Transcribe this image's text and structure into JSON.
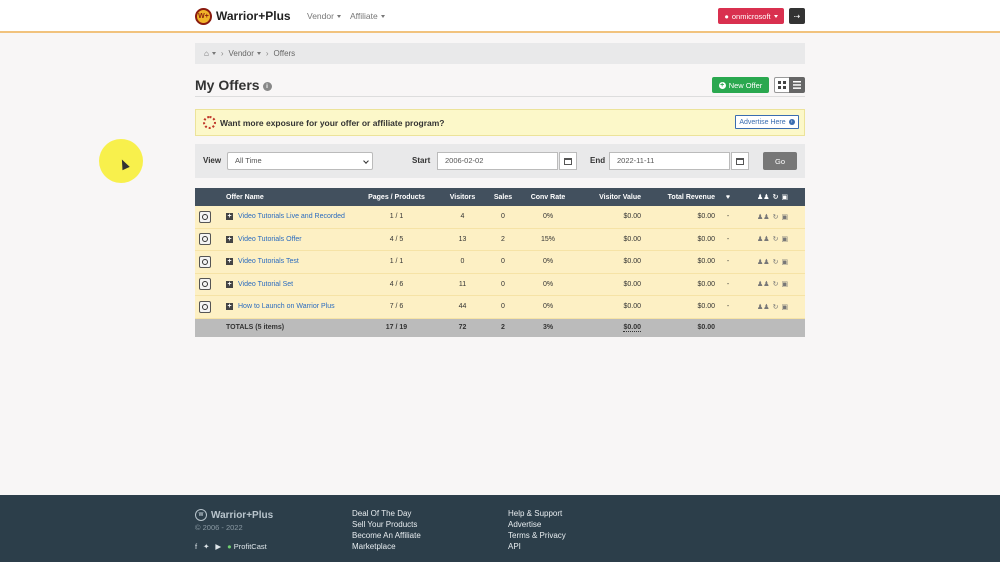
{
  "brand": {
    "name": "Warrior+Plus",
    "badge": "W+"
  },
  "topnav": {
    "vendor": "Vendor",
    "affiliate": "Affiliate",
    "user": "onmicrosoft"
  },
  "breadcrumb": {
    "vendor": "Vendor",
    "current": "Offers"
  },
  "page": {
    "title": "My Offers",
    "new_offer": "New Offer"
  },
  "banner": {
    "text": "Want more exposure for your offer or affiliate program?",
    "button": "Advertise Here"
  },
  "filter": {
    "view_label": "View",
    "view_value": "All Time",
    "start_label": "Start",
    "start_value": "2006-02-02",
    "end_label": "End",
    "end_value": "2022-11-11",
    "go": "Go"
  },
  "table": {
    "headers": {
      "name": "Offer Name",
      "pages": "Pages / Products",
      "visitors": "Visitors",
      "sales": "Sales",
      "conv": "Conv Rate",
      "visitor_value": "Visitor Value",
      "revenue": "Total Revenue"
    },
    "rows": [
      {
        "name": "Video Tutorials Live and Recorded",
        "pages": "1 / 1",
        "visitors": "4",
        "sales": "0",
        "conv": "0%",
        "visitor_value": "$0.00",
        "revenue": "$0.00",
        "fav": "-"
      },
      {
        "name": "Video Tutorials Offer",
        "pages": "4 / 5",
        "visitors": "13",
        "sales": "2",
        "conv": "15%",
        "visitor_value": "$0.00",
        "revenue": "$0.00",
        "fav": "-"
      },
      {
        "name": "Video Tutorials Test",
        "pages": "1 / 1",
        "visitors": "0",
        "sales": "0",
        "conv": "0%",
        "visitor_value": "$0.00",
        "revenue": "$0.00",
        "fav": "-"
      },
      {
        "name": "Video Tutorial Set",
        "pages": "4 / 6",
        "visitors": "11",
        "sales": "0",
        "conv": "0%",
        "visitor_value": "$0.00",
        "revenue": "$0.00",
        "fav": "-"
      },
      {
        "name": "How to Launch on Warrior Plus",
        "pages": "7 / 6",
        "visitors": "44",
        "sales": "0",
        "conv": "0%",
        "visitor_value": "$0.00",
        "revenue": "$0.00",
        "fav": "-"
      }
    ],
    "totals": {
      "label": "TOTALS (5 items)",
      "pages": "17 / 19",
      "visitors": "72",
      "sales": "2",
      "conv": "3%",
      "visitor_value": "$0.00",
      "revenue": "$0.00"
    }
  },
  "footer": {
    "brand": "Warrior+Plus",
    "copyright": "© 2006 - 2022",
    "profitcast": "ProfitCast",
    "col1": [
      "Deal Of The Day",
      "Sell Your Products",
      "Become An Affiliate",
      "Marketplace"
    ],
    "col2": [
      "Help & Support",
      "Advertise",
      "Terms & Privacy",
      "API"
    ]
  },
  "colors": {
    "accent": "#d9304f",
    "success": "#2aa84f",
    "table_header": "#42505e",
    "row_bg": "#fdf0c4",
    "footer_bg": "#2c3e4a"
  }
}
